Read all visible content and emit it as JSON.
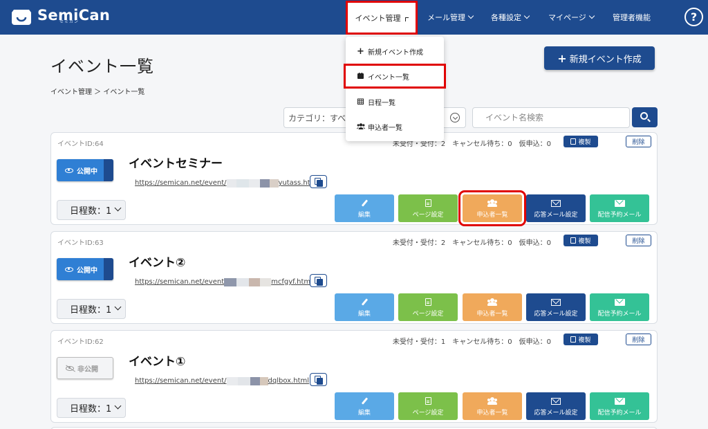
{
  "app": {
    "name": "SemiCan",
    "subtitle": "セミカン"
  },
  "nav": {
    "items": [
      {
        "label": "イベント管理"
      },
      {
        "label": "メール管理"
      },
      {
        "label": "各種設定"
      },
      {
        "label": "マイページ"
      },
      {
        "label": "管理者機能"
      }
    ],
    "help": "?"
  },
  "dropdown": {
    "items": [
      {
        "icon": "+",
        "label": "新規イベント作成"
      },
      {
        "icon": "▬",
        "label": "イベント一覧"
      },
      {
        "icon": "▦",
        "label": "日程一覧"
      },
      {
        "icon": "👥",
        "label": "申込者一覧"
      }
    ]
  },
  "page": {
    "title": "イベント一覧",
    "breadcrumb": "イベント管理 ＞ イベント一覧",
    "new_button": "新規イベント作成"
  },
  "filters": {
    "category_value": "カテゴリ：すべて",
    "search_placeholder": "イベント名検索"
  },
  "labels": {
    "copy": "複製",
    "delete": "削除",
    "published": "公開中",
    "unpublished": "非公開",
    "edit": "編集",
    "page_settings": "ページ設定",
    "applicants": "申込者一覧",
    "reply_mail": "応答メール設定",
    "scheduled_mail": "配信予約メール"
  },
  "events": [
    {
      "id_label": "イベントID:64",
      "stats": "未受付・受付：2　キャンセル待ち：0　仮申込：0",
      "status": "published",
      "title": "イベントセミナー",
      "url_prefix": "https://semican.net/event/",
      "url_suffix": "yutass.html",
      "schedule": "日程数：1"
    },
    {
      "id_label": "イベントID:63",
      "stats": "未受付・受付：2　キャンセル待ち：0　仮申込：0",
      "status": "published",
      "title": "イベント②",
      "url_prefix": "https://semican.net/event",
      "url_suffix": "mcfgyf.html",
      "schedule": "日程数：1"
    },
    {
      "id_label": "イベントID:62",
      "stats": "未受付・受付：1　キャンセル待ち：0　仮申込：0",
      "status": "unpublished",
      "title": "イベント①",
      "url_prefix": "https://semican.net/event/",
      "url_suffix": "dqlbox.html",
      "schedule": "日程数：1"
    }
  ],
  "colors": {
    "nav_bg": "#1e4b8f",
    "highlight": "#e00000",
    "edit": "#5aa9e6",
    "page_settings": "#7cc04a",
    "applicants": "#f0a95b",
    "reply_mail": "#1e4b8f",
    "scheduled_mail": "#34c296"
  }
}
